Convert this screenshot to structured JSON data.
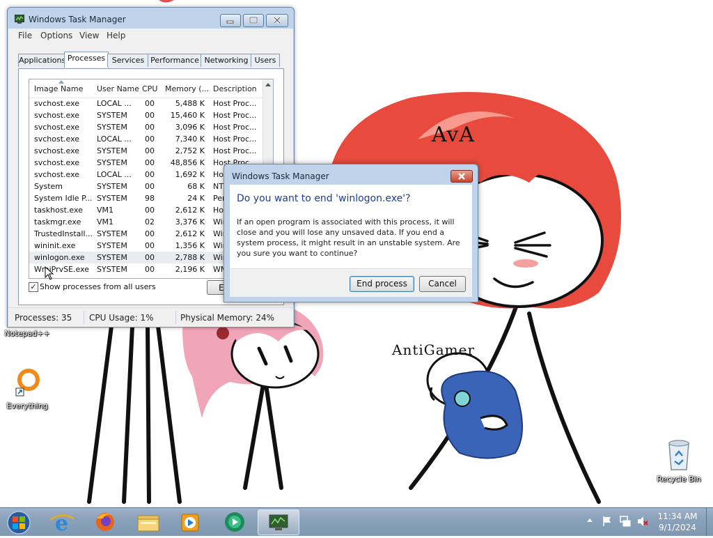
{
  "desktop": {
    "bg_color": "#ffffff",
    "icons": [
      {
        "label": "Notepad++"
      },
      {
        "label": "Everything"
      },
      {
        "label": "Recycle Bin"
      }
    ],
    "art_labels": {
      "character_1": "AvA",
      "character_2": "AntiGamer"
    }
  },
  "task_manager": {
    "title": "Windows Task Manager",
    "menu": [
      "File",
      "Options",
      "View",
      "Help"
    ],
    "tabs": [
      "Applications",
      "Processes",
      "Services",
      "Performance",
      "Networking",
      "Users"
    ],
    "active_tab": "Processes",
    "columns": [
      "Image Name",
      "User Name",
      "CPU",
      "Memory (...",
      "Description"
    ],
    "processes": [
      {
        "name": "svchost.exe",
        "user": "LOCAL ...",
        "cpu": "00",
        "mem": "5,488 K",
        "desc": "Host Proc..."
      },
      {
        "name": "svchost.exe",
        "user": "SYSTEM",
        "cpu": "00",
        "mem": "15,460 K",
        "desc": "Host Proc..."
      },
      {
        "name": "svchost.exe",
        "user": "SYSTEM",
        "cpu": "00",
        "mem": "3,096 K",
        "desc": "Host Proc..."
      },
      {
        "name": "svchost.exe",
        "user": "LOCAL ...",
        "cpu": "00",
        "mem": "7,340 K",
        "desc": "Host Proc..."
      },
      {
        "name": "svchost.exe",
        "user": "SYSTEM",
        "cpu": "00",
        "mem": "2,752 K",
        "desc": "Host Proc..."
      },
      {
        "name": "svchost.exe",
        "user": "SYSTEM",
        "cpu": "00",
        "mem": "48,856 K",
        "desc": "Host Proc..."
      },
      {
        "name": "svchost.exe",
        "user": "LOCAL ...",
        "cpu": "00",
        "mem": "1,692 K",
        "desc": "Hos"
      },
      {
        "name": "System",
        "user": "SYSTEM",
        "cpu": "00",
        "mem": "68 K",
        "desc": "NT"
      },
      {
        "name": "System Idle P...",
        "user": "SYSTEM",
        "cpu": "98",
        "mem": "24 K",
        "desc": "Per"
      },
      {
        "name": "taskhost.exe",
        "user": "VM1",
        "cpu": "00",
        "mem": "2,612 K",
        "desc": "Hos"
      },
      {
        "name": "taskmgr.exe",
        "user": "VM1",
        "cpu": "02",
        "mem": "3,376 K",
        "desc": "Win"
      },
      {
        "name": "TrustedInstall...",
        "user": "SYSTEM",
        "cpu": "00",
        "mem": "2,612 K",
        "desc": "Win"
      },
      {
        "name": "wininit.exe",
        "user": "SYSTEM",
        "cpu": "00",
        "mem": "1,356 K",
        "desc": "Win"
      },
      {
        "name": "winlogon.exe",
        "user": "SYSTEM",
        "cpu": "00",
        "mem": "2,788 K",
        "desc": "Win",
        "selected": true
      },
      {
        "name": "WmiPrvSE.exe",
        "user": "SYSTEM",
        "cpu": "00",
        "mem": "2,196 K",
        "desc": "WM"
      }
    ],
    "show_all_label": "Show processes from all users",
    "show_all_checked": true,
    "end_button_label": "E",
    "status": {
      "processes": "Processes: 35",
      "cpu": "CPU Usage: 1%",
      "memory": "Physical Memory: 24%"
    }
  },
  "dialog": {
    "title": "Windows Task Manager",
    "heading": "Do you want to end 'winlogon.exe'?",
    "body": "If an open program is associated with this process, it will close and you will lose any unsaved data. If you end a system process, it might result in an unstable system. Are you sure you want to continue?",
    "confirm_label": "End process",
    "cancel_label": "Cancel"
  },
  "taskbar": {
    "apps": [
      "start-orb-icon",
      "internet-explorer-icon",
      "firefox-icon",
      "file-explorer-icon",
      "media-player-icon",
      "media-center-icon",
      "task-manager-icon"
    ],
    "clock_time": "11:34 AM",
    "clock_date": "9/1/2024"
  },
  "colors": {
    "window_frame": "#bfd3ea",
    "dialog_heading": "#1e3f8f",
    "close_red": "#c8442e"
  }
}
